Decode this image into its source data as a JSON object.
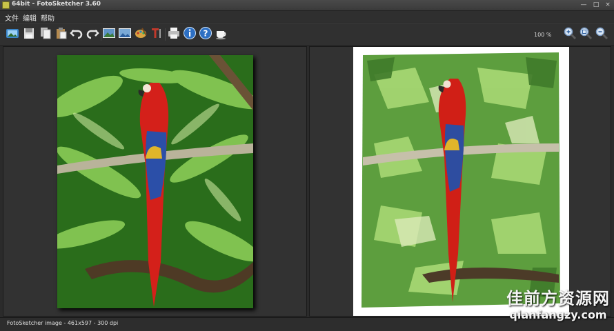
{
  "window": {
    "title": "64bit - FotoSketcher 3.60",
    "controls": {
      "minimize": "—",
      "maximize": "□",
      "close": "×"
    }
  },
  "menu": {
    "items": [
      {
        "label": "文件"
      },
      {
        "label": "编辑"
      },
      {
        "label": "帮助"
      }
    ]
  },
  "toolbar": {
    "zoom": "100 %",
    "buttons": [
      "open-image-icon",
      "save-icon",
      "copy-icon",
      "paste-icon",
      "undo-icon",
      "redo-icon",
      "process-image-icon",
      "batch-process-icon",
      "drawing-parameters-icon",
      "add-text-icon",
      "print-icon",
      "info-icon",
      "help-icon",
      "donate-cup-icon",
      "zoom-in-icon",
      "zoom-fit-icon",
      "zoom-out-icon"
    ]
  },
  "status": {
    "text": "FotoSketcher image - 461x597 - 300 dpi"
  },
  "watermark": {
    "title": "佳前方资源网",
    "url": "qianfangzy.com"
  }
}
